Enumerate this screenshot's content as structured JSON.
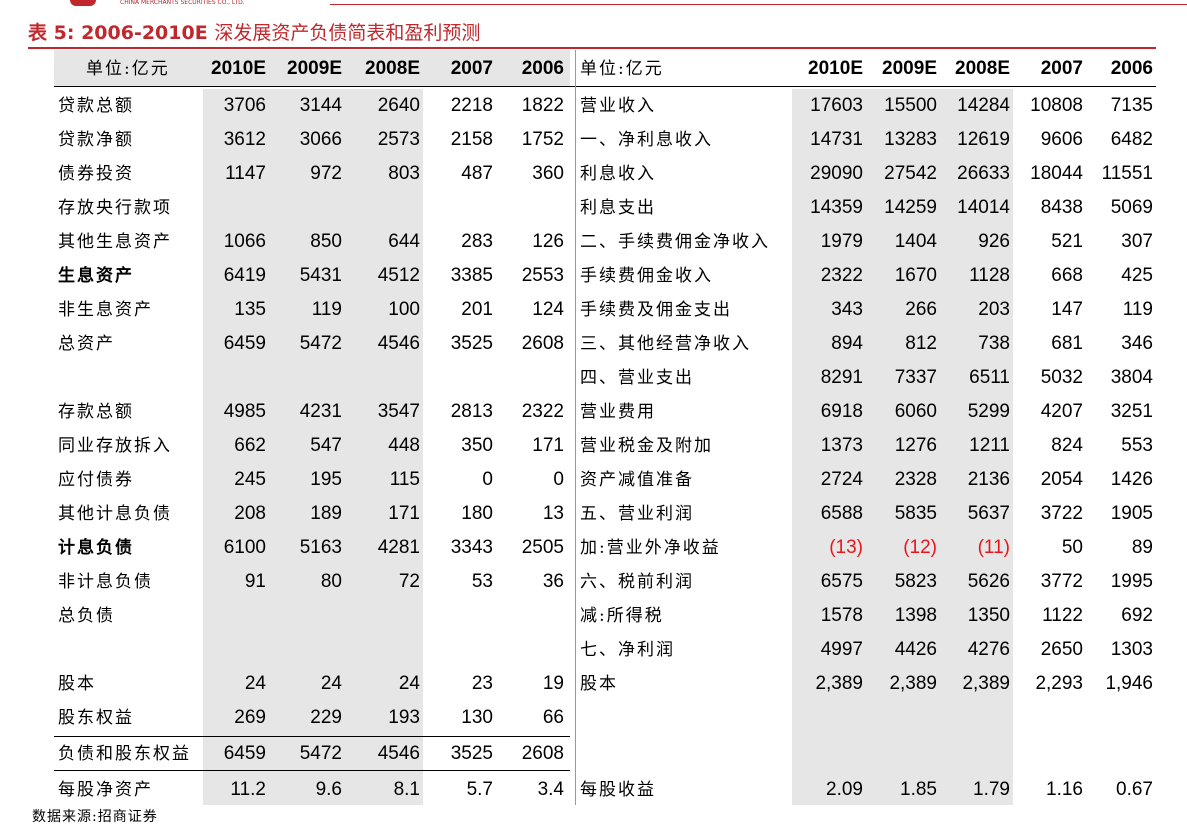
{
  "brand": {
    "strip_text": "CHINA MERCHANTS SECURITIES CO., LTD."
  },
  "title": {
    "prefix": "表 5:",
    "years": "2006-2010E",
    "text": "深发展资产负债简表和盈利预测"
  },
  "left": {
    "unit": "单位:亿元",
    "columns": [
      "2010E",
      "2009E",
      "2008E",
      "2007",
      "2006"
    ],
    "rows": [
      {
        "label": "贷款总额",
        "values": [
          "3706",
          "3144",
          "2640",
          "2218",
          "1822"
        ]
      },
      {
        "label": "贷款净额",
        "values": [
          "3612",
          "3066",
          "2573",
          "2158",
          "1752"
        ]
      },
      {
        "label": "债券投资",
        "values": [
          "1147",
          "972",
          "803",
          "487",
          "360"
        ]
      },
      {
        "label": "存放央行款项",
        "values": [
          "",
          "",
          "",
          "",
          ""
        ]
      },
      {
        "label": "其他生息资产",
        "values": [
          "1066",
          "850",
          "644",
          "283",
          "126"
        ]
      },
      {
        "label": "生息资产",
        "values": [
          "6419",
          "5431",
          "4512",
          "3385",
          "2553"
        ],
        "bold": true
      },
      {
        "label": "非生息资产",
        "values": [
          "135",
          "119",
          "100",
          "201",
          "124"
        ]
      },
      {
        "label": "总资产",
        "values": [
          "6459",
          "5472",
          "4546",
          "3525",
          "2608"
        ]
      },
      {
        "label": "",
        "values": [
          "",
          "",
          "",
          "",
          ""
        ]
      },
      {
        "label": "存款总额",
        "values": [
          "4985",
          "4231",
          "3547",
          "2813",
          "2322"
        ]
      },
      {
        "label": "同业存放拆入",
        "values": [
          "662",
          "547",
          "448",
          "350",
          "171"
        ]
      },
      {
        "label": "应付债券",
        "values": [
          "245",
          "195",
          "115",
          "0",
          "0"
        ]
      },
      {
        "label": "其他计息负债",
        "values": [
          "208",
          "189",
          "171",
          "180",
          "13"
        ]
      },
      {
        "label": "计息负债",
        "values": [
          "6100",
          "5163",
          "4281",
          "3343",
          "2505"
        ],
        "bold": true
      },
      {
        "label": "非计息负债",
        "values": [
          "91",
          "80",
          "72",
          "53",
          "36"
        ]
      },
      {
        "label": "总负债",
        "values": [
          "",
          "",
          "",
          "",
          ""
        ]
      },
      {
        "label": "",
        "values": [
          "",
          "",
          "",
          "",
          ""
        ]
      },
      {
        "label": "股本",
        "values": [
          "24",
          "24",
          "24",
          "23",
          "19"
        ]
      },
      {
        "label": "股东权益",
        "values": [
          "269",
          "229",
          "193",
          "130",
          "66"
        ]
      },
      {
        "label": "负债和股东权益",
        "values": [
          "6459",
          "5472",
          "4546",
          "3525",
          "2608"
        ]
      },
      {
        "label": "每股净资产",
        "values": [
          "11.2",
          "9.6",
          "8.1",
          "5.7",
          "3.4"
        ]
      }
    ]
  },
  "right": {
    "unit": "单位:亿元",
    "columns": [
      "2010E",
      "2009E",
      "2008E",
      "2007",
      "2006"
    ],
    "rows": [
      {
        "label": "营业收入",
        "values": [
          "17603",
          "15500",
          "14284",
          "10808",
          "7135"
        ]
      },
      {
        "label": "一、净利息收入",
        "values": [
          "14731",
          "13283",
          "12619",
          "9606",
          "6482"
        ]
      },
      {
        "label": "利息收入",
        "values": [
          "29090",
          "27542",
          "26633",
          "18044",
          "11551"
        ]
      },
      {
        "label": "利息支出",
        "values": [
          "14359",
          "14259",
          "14014",
          "8438",
          "5069"
        ]
      },
      {
        "label": "二、手续费佣金净收入",
        "values": [
          "1979",
          "1404",
          "926",
          "521",
          "307"
        ]
      },
      {
        "label": "手续费佣金收入",
        "values": [
          "2322",
          "1670",
          "1128",
          "668",
          "425"
        ]
      },
      {
        "label": "手续费及佣金支出",
        "values": [
          "343",
          "266",
          "203",
          "147",
          "119"
        ]
      },
      {
        "label": "三、其他经营净收入",
        "values": [
          "894",
          "812",
          "738",
          "681",
          "346"
        ]
      },
      {
        "label": "四、营业支出",
        "values": [
          "8291",
          "7337",
          "6511",
          "5032",
          "3804"
        ]
      },
      {
        "label": "营业费用",
        "values": [
          "6918",
          "6060",
          "5299",
          "4207",
          "3251"
        ]
      },
      {
        "label": "营业税金及附加",
        "values": [
          "1373",
          "1276",
          "1211",
          "824",
          "553"
        ]
      },
      {
        "label": "资产减值准备",
        "values": [
          "2724",
          "2328",
          "2136",
          "2054",
          "1426"
        ]
      },
      {
        "label": "五、营业利润",
        "values": [
          "6588",
          "5835",
          "5637",
          "3722",
          "1905"
        ]
      },
      {
        "label": "加:营业外净收益",
        "values": [
          "(13)",
          "(12)",
          "(11)",
          "50",
          "89"
        ]
      },
      {
        "label": "六、税前利润",
        "values": [
          "6575",
          "5823",
          "5626",
          "3772",
          "1995"
        ]
      },
      {
        "label": "减:所得税",
        "values": [
          "1578",
          "1398",
          "1350",
          "1122",
          "692"
        ]
      },
      {
        "label": "七、净利润",
        "values": [
          "4997",
          "4426",
          "4276",
          "2650",
          "1303"
        ]
      },
      {
        "label": "股本",
        "values": [
          "2,389",
          "2,389",
          "2,389",
          "2,293",
          "1,946"
        ]
      },
      {
        "label": "",
        "values": [
          "",
          "",
          "",
          "",
          ""
        ]
      },
      {
        "label": "",
        "values": [
          "",
          "",
          "",
          "",
          ""
        ]
      },
      {
        "label": "每股收益",
        "values": [
          "2.09",
          "1.85",
          "1.79",
          "1.16",
          "0.67"
        ]
      }
    ]
  },
  "colors": {
    "accent": "#c0282d",
    "negative": "#e8161b",
    "shade": "#e6e6e6"
  },
  "footer": {
    "source": "数据来源:招商证券"
  }
}
